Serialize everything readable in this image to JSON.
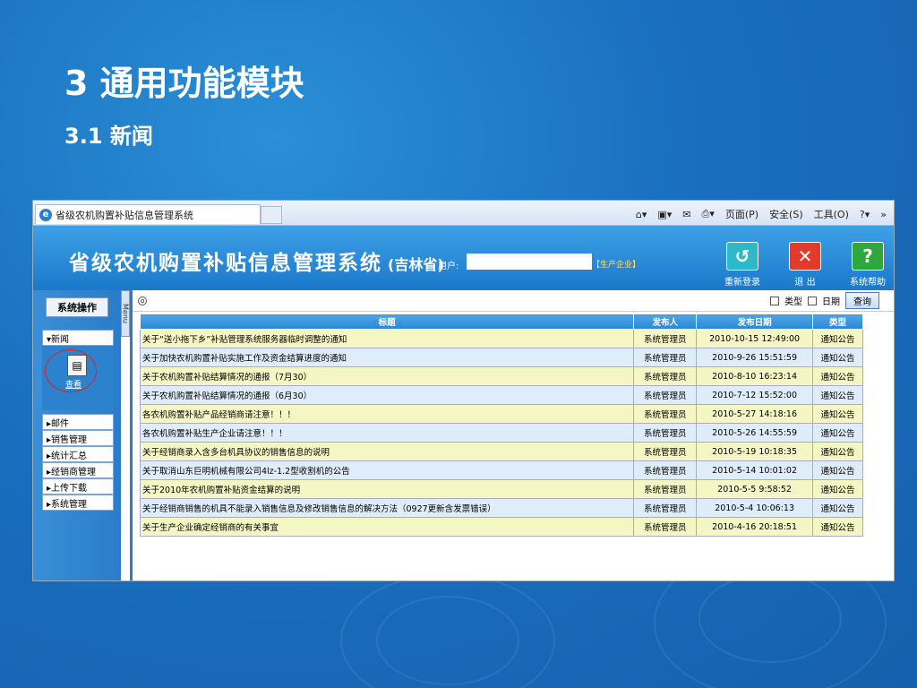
{
  "slide": {
    "title": "3 通用功能模块",
    "subtitle": "3.1 新闻"
  },
  "browser": {
    "tab_title": "省级农机购置补贴信息管理系统",
    "tools": [
      "页面(P)",
      "安全(S)",
      "工具(O)"
    ],
    "more": "»"
  },
  "header": {
    "app_title": "省级农机购置补贴信息管理系统",
    "province": "(吉林省)",
    "user_label": "用户:",
    "user_role": "【生产企业】",
    "buttons": [
      {
        "label": "重新登录",
        "icon": "↺",
        "color": "#2fb8c8"
      },
      {
        "label": "退  出",
        "icon": "✕",
        "color": "#e33b2b"
      },
      {
        "label": "系统帮助",
        "icon": "?",
        "color": "#2ea83a"
      }
    ]
  },
  "sidebar": {
    "system_button": "系统操作",
    "menu_tab": "Menu",
    "news_label": "▾新闻",
    "view_label": "查看",
    "items": [
      "▸邮件",
      "▸销售管理",
      "▸统计汇总",
      "▸经销商管理",
      "▸上传下载",
      "▸系统管理"
    ]
  },
  "toolbar": {
    "type_label": "类型",
    "date_label": "日期",
    "query_button": "查询"
  },
  "table": {
    "headers": [
      "标题",
      "发布人",
      "发布日期",
      "类型"
    ],
    "rows": [
      [
        "关于“送小拖下乡”补贴管理系统服务器临时调整的通知",
        "系统管理员",
        "2010-10-15 12:49:00",
        "通知公告"
      ],
      [
        "关于加快农机购置补贴实施工作及资金结算进度的通知",
        "系统管理员",
        "2010-9-26 15:51:59",
        "通知公告"
      ],
      [
        "关于农机购置补贴结算情况的通报（7月30）",
        "系统管理员",
        "2010-8-10 16:23:14",
        "通知公告"
      ],
      [
        "关于农机购置补贴结算情况的通报（6月30）",
        "系统管理员",
        "2010-7-12 15:52:00",
        "通知公告"
      ],
      [
        "各农机购置补贴产品经销商请注意！！！",
        "系统管理员",
        "2010-5-27 14:18:16",
        "通知公告"
      ],
      [
        "各农机购置补贴生产企业请注意！！！",
        "系统管理员",
        "2010-5-26 14:55:59",
        "通知公告"
      ],
      [
        "关于经销商录入含多台机具协议的销售信息的说明",
        "系统管理员",
        "2010-5-19 10:18:35",
        "通知公告"
      ],
      [
        "关于取消山东巨明机械有限公司4lz-1.2型收割机的公告",
        "系统管理员",
        "2010-5-14 10:01:02",
        "通知公告"
      ],
      [
        "关于2010年农机购置补贴资金结算的说明",
        "系统管理员",
        "2010-5-5 9:58:52",
        "通知公告"
      ],
      [
        "关于经销商销售的机具不能录入销售信息及修改销售信息的解决方法（0927更新含发票错误）",
        "系统管理员",
        "2010-5-4 10:06:13",
        "通知公告"
      ],
      [
        "关于生产企业确定经销商的有关事宜",
        "系统管理员",
        "2010-4-16 20:18:51",
        "通知公告"
      ]
    ]
  }
}
